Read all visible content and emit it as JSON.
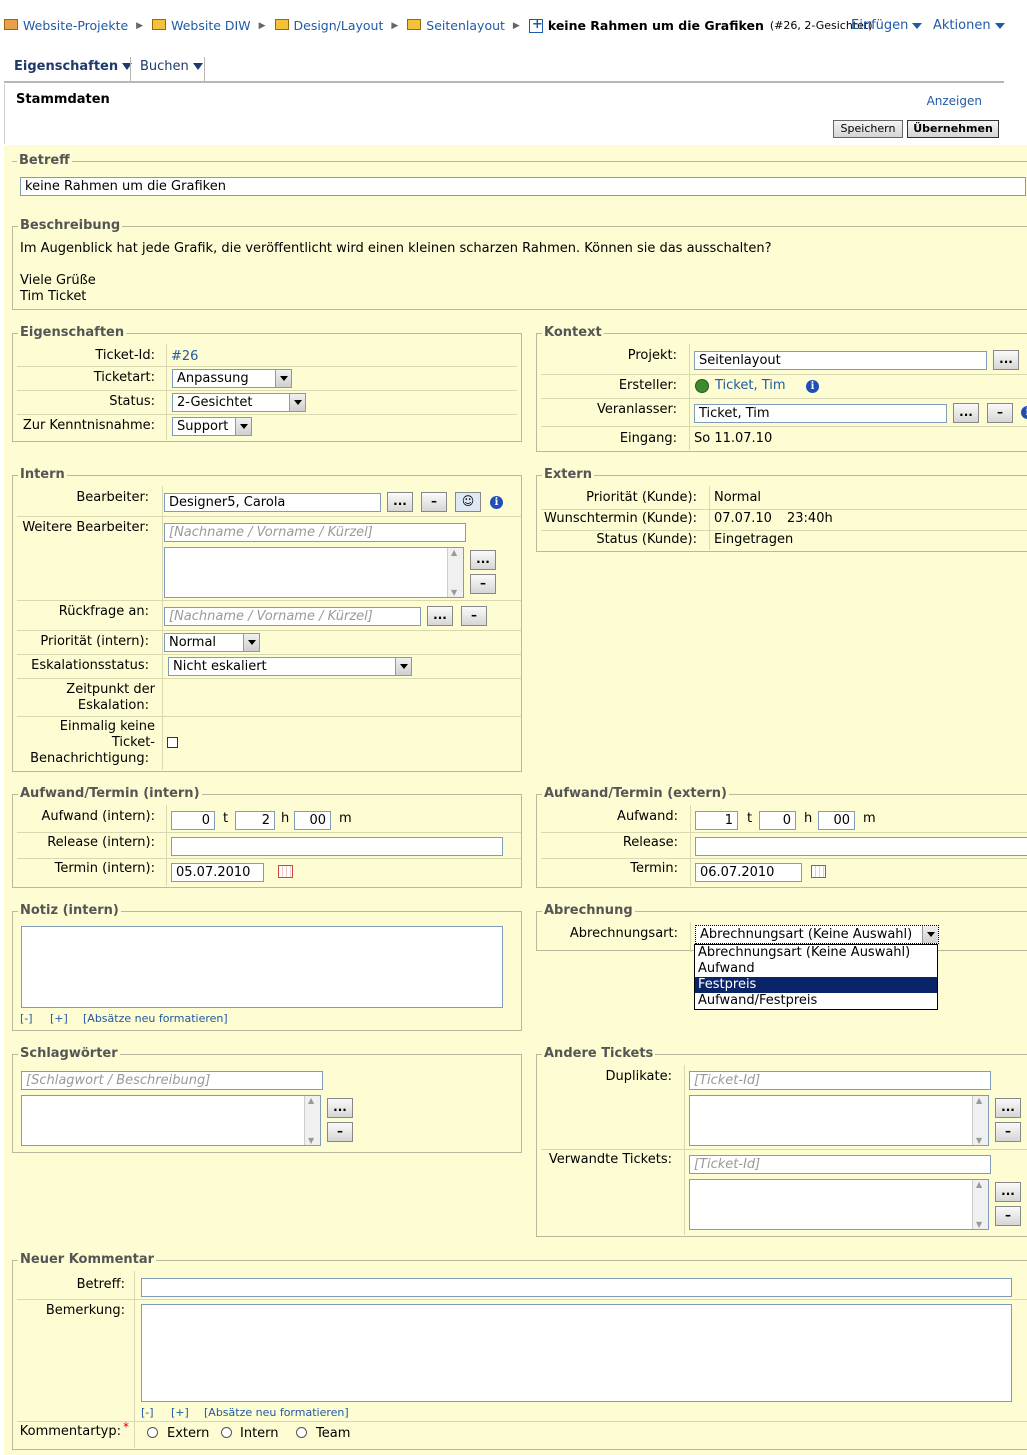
{
  "breadcrumb": [
    {
      "label": "Website-Projekte"
    },
    {
      "label": "Website DIW"
    },
    {
      "label": "Design/Layout"
    },
    {
      "label": "Seitenlayout"
    }
  ],
  "ticket_title": "keine Rahmen um die Grafiken",
  "ticket_sub": "(#26, 2-Gesichtet)",
  "menu": {
    "insert": "Einfügen",
    "actions": "Aktionen"
  },
  "tabs": {
    "properties": "Eigenschaften",
    "book": "Buchen"
  },
  "header": {
    "title": "Stammdaten",
    "show": "Anzeigen",
    "save": "Speichern",
    "apply": "Übernehmen"
  },
  "betreff": {
    "legend": "Betreff",
    "value": "keine Rahmen um die Grafiken"
  },
  "beschreibung": {
    "legend": "Beschreibung",
    "line1": "Im Augenblick hat jede Grafik, die veröffentlicht wird einen kleinen scharzen Rahmen. Können sie das ausschalten?",
    "line2": "Viele Grüße",
    "line3": "Tim Ticket"
  },
  "eigenschaften": {
    "legend": "Eigenschaften",
    "ticket_id_label": "Ticket-Id:",
    "ticket_id": "#26",
    "type_label": "Ticketart:",
    "type": "Anpassung",
    "status_label": "Status:",
    "status": "2-Gesichtet",
    "notice_label": "Zur Kenntnisnahme:",
    "notice": "Support"
  },
  "kontext": {
    "legend": "Kontext",
    "project_label": "Projekt:",
    "project": "Seitenlayout",
    "creator_label": "Ersteller:",
    "creator": "Ticket, Tim",
    "initiator_label": "Veranlasser:",
    "initiator": "Ticket, Tim",
    "received_label": "Eingang:",
    "received": "So 11.07.10"
  },
  "intern": {
    "legend": "Intern",
    "editor_label": "Bearbeiter:",
    "editor": "Designer5, Carola",
    "more_editors_label": "Weitere Bearbeiter:",
    "name_placeholder": "[Nachname / Vorname / Kürzel]",
    "query_label": "Rückfrage an:",
    "priority_label": "Priorität (intern):",
    "priority": "Normal",
    "escalation_label": "Eskalationsstatus:",
    "escalation": "Nicht eskaliert",
    "esc_time_label1": "Zeitpunkt der",
    "esc_time_label2": "Eskalation:",
    "once_label1": "Einmalig keine",
    "once_label2": "Ticket-",
    "once_label3": "Benachrichtigung:"
  },
  "extern": {
    "legend": "Extern",
    "priority_label": "Priorität (Kunde):",
    "priority": "Normal",
    "wish_label": "Wunschtermin (Kunde):",
    "wish": "07.07.10",
    "wish_time": "23:40h",
    "status_label": "Status (Kunde):",
    "status": "Eingetragen"
  },
  "aufwand_intern": {
    "legend": "Aufwand/Termin (intern)",
    "effort_label": "Aufwand (intern):",
    "days": "0",
    "hours": "2",
    "minutes": "00",
    "unit_d": "t",
    "unit_h": "h",
    "unit_m": "m",
    "release_label": "Release (intern):",
    "date_label": "Termin (intern):",
    "date": "05.07.2010"
  },
  "aufwand_extern": {
    "legend": "Aufwand/Termin (extern)",
    "effort_label": "Aufwand:",
    "days": "1",
    "hours": "0",
    "minutes": "00",
    "release_label": "Release:",
    "date_label": "Termin:",
    "date": "06.07.2010"
  },
  "notiz": {
    "legend": "Notiz (intern)",
    "collapse": "[-]",
    "expand": "[+]",
    "reformat": "[Absätze neu formatieren]"
  },
  "abrechnung": {
    "legend": "Abrechnung",
    "type_label": "Abrechnungsart:",
    "selected": "Abrechnungsart (Keine Auswahl)",
    "options": [
      "Abrechnungsart (Keine Auswahl)",
      "Aufwand",
      "Festpreis",
      "Aufwand/Festpreis"
    ]
  },
  "schlagwoerter": {
    "legend": "Schlagwörter",
    "placeholder": "[Schlagwort / Beschreibung]"
  },
  "andere": {
    "legend": "Andere Tickets",
    "dup_label": "Duplikate:",
    "related_label": "Verwandte Tickets:",
    "placeholder": "[Ticket-Id]"
  },
  "kommentar": {
    "legend": "Neuer Kommentar",
    "subject_label": "Betreff:",
    "remark_label": "Bemerkung:",
    "type_label": "Kommentartyp:",
    "required": "*",
    "opt_extern": "Extern",
    "opt_intern": "Intern",
    "opt_team": "Team"
  },
  "btn": {
    "dots": "...",
    "minus": "–"
  }
}
